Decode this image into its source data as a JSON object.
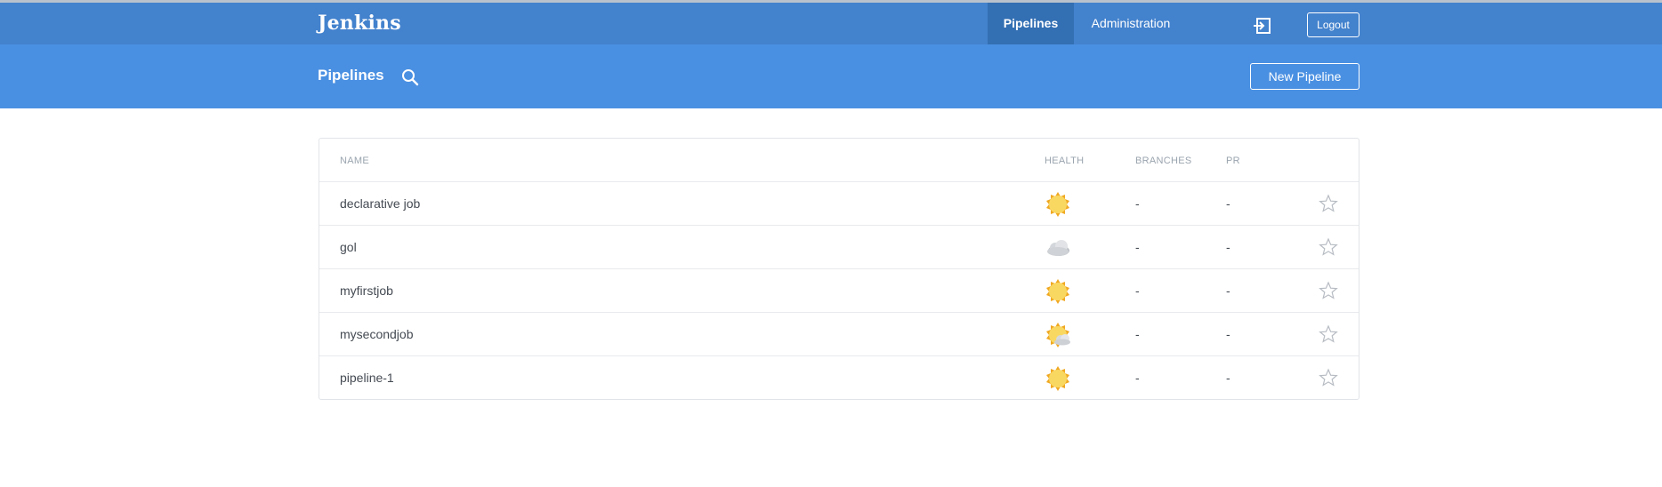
{
  "navbar": {
    "brand": "Jenkins",
    "tabs": [
      {
        "label": "Pipelines",
        "active": true
      },
      {
        "label": "Administration",
        "active": false
      }
    ],
    "signout_icon": "sign-out-icon",
    "logout_label": "Logout"
  },
  "header": {
    "title": "Pipelines",
    "search_icon": "search-icon",
    "new_pipeline_label": "New Pipeline"
  },
  "table": {
    "columns": [
      "NAME",
      "HEALTH",
      "BRANCHES",
      "PR"
    ],
    "rows": [
      {
        "name": "declarative job",
        "health": "sunny",
        "branches": "-",
        "pr": "-",
        "favorite": false
      },
      {
        "name": "gol",
        "health": "cloudy",
        "branches": "-",
        "pr": "-",
        "favorite": false
      },
      {
        "name": "myfirstjob",
        "health": "sunny",
        "branches": "-",
        "pr": "-",
        "favorite": false
      },
      {
        "name": "mysecondjob",
        "health": "partly-cloudy",
        "branches": "-",
        "pr": "-",
        "favorite": false
      },
      {
        "name": "pipeline-1",
        "health": "sunny",
        "branches": "-",
        "pr": "-",
        "favorite": false
      }
    ]
  },
  "colors": {
    "navbar": "#4382cd",
    "navbar_active": "#336fb3",
    "header": "#4a90e2",
    "sun": "#f7d44c",
    "cloud": "#c9ccd1"
  }
}
